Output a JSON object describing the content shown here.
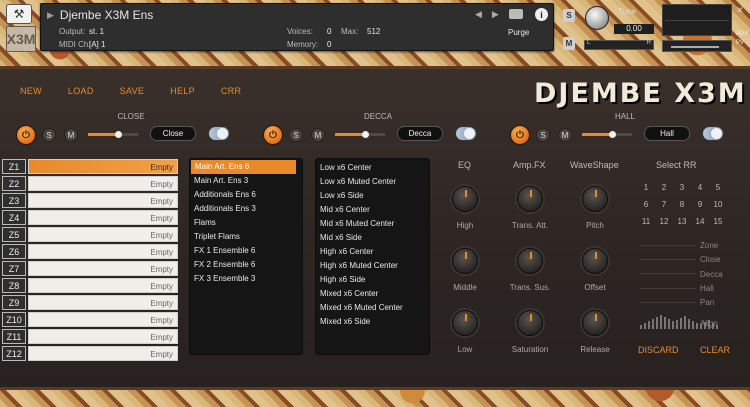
{
  "header": {
    "instrument_name": "Djembe X3M Ens",
    "output_label": "Output:",
    "output_value": "st. 1",
    "midi_label": "MIDI Ch:",
    "midi_value": "[A]  1",
    "voices_label": "Voices:",
    "voices_value": "0",
    "max_label": "Max:",
    "max_value": "512",
    "memory_label": "Memory:",
    "memory_value": "0",
    "purge_label": "Purge",
    "tune_label": "Tune",
    "tune_value": "0.00",
    "solo_label": "S",
    "mute_label": "M",
    "pan_left": "L",
    "pan_right": "R",
    "aux_label": "AUX",
    "pv_label": "PV",
    "logo_text": "X3M"
  },
  "menu": {
    "new": "NEW",
    "load": "LOAD",
    "save": "SAVE",
    "help": "HELP",
    "rr": "CRR"
  },
  "brand_title": "DJEMBE X3M",
  "mics": [
    {
      "label": "CLOSE",
      "room": "Close",
      "solo": "S",
      "mute": "M",
      "level": 0.6
    },
    {
      "label": "DECCA",
      "room": "Decca",
      "solo": "S",
      "mute": "M",
      "level": 0.6
    },
    {
      "label": "HALL",
      "room": "Hall",
      "solo": "S",
      "mute": "M",
      "level": 0.6
    }
  ],
  "zones": [
    {
      "id": "Z1",
      "value": "Empty",
      "active": true
    },
    {
      "id": "Z2",
      "value": "Empty"
    },
    {
      "id": "Z3",
      "value": "Empty"
    },
    {
      "id": "Z4",
      "value": "Empty"
    },
    {
      "id": "Z5",
      "value": "Empty"
    },
    {
      "id": "Z6",
      "value": "Empty"
    },
    {
      "id": "Z7",
      "value": "Empty"
    },
    {
      "id": "Z8",
      "value": "Empty"
    },
    {
      "id": "Z9",
      "value": "Empty"
    },
    {
      "id": "Z10",
      "value": "Empty"
    },
    {
      "id": "Z11",
      "value": "Empty"
    },
    {
      "id": "Z12",
      "value": "Empty"
    }
  ],
  "ensembles": [
    "Main Art. Ens 6",
    "Main Art. Ens 3",
    "Additionals Ens 6",
    "Additionals Ens 3",
    "Flams",
    "Triplet Flams",
    "FX 1 Ensemble 6",
    "FX 2 Ensemble 6",
    "FX 3 Ensemble 3"
  ],
  "articulations": [
    "Low x6 Center",
    "Low x6 Muted Center",
    "Low x6 Side",
    "Mid x6 Center",
    "Mid x6 Muted Center",
    "Mid x6 Side",
    "High x6 Center",
    "High x6 Muted Center",
    "High x6 Side",
    "Mixed x6 Center",
    "Mixed x6 Muted Center",
    "Mixed x6 Side"
  ],
  "fx": {
    "eq_title": "EQ",
    "amp_title": "Amp.FX",
    "wave_title": "WaveShape",
    "rr_title": "Select RR",
    "eq_knobs": [
      "High",
      "Middle",
      "Low"
    ],
    "amp_knobs": [
      "Trans. Att.",
      "Trans. Sus.",
      "Saturation"
    ],
    "wave_knobs": [
      "Pitch",
      "Offset",
      "Release"
    ]
  },
  "rr_numbers": [
    "1",
    "2",
    "3",
    "4",
    "5",
    "6",
    "7",
    "8",
    "9",
    "10",
    "11",
    "12",
    "13",
    "14",
    "15"
  ],
  "side_labels": [
    "Zone",
    "Close",
    "Decca",
    "Hall",
    "Pan",
    "Align"
  ],
  "actions": {
    "discard": "DISCARD",
    "clear": "CLEAR"
  }
}
